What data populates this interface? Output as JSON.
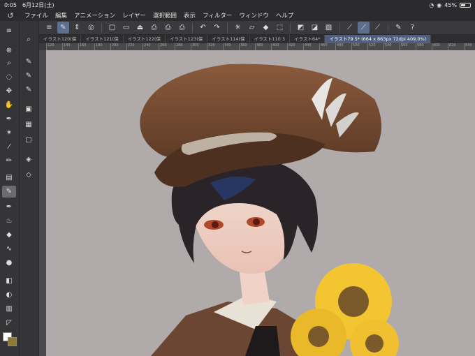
{
  "status": {
    "time": "0:05",
    "date": "6月12日(土)",
    "battery": "45%",
    "battery_level": 0.45
  },
  "menu": {
    "items": [
      "ファイル",
      "編集",
      "アニメーション",
      "レイヤー",
      "選択範囲",
      "表示",
      "フィルター",
      "ウィンドウ",
      "ヘルプ"
    ]
  },
  "tabs": [
    {
      "label": "イラスト120(保"
    },
    {
      "label": "イラスト121(保"
    },
    {
      "label": "イラスト122(保"
    },
    {
      "label": "イラスト123(保"
    },
    {
      "label": "イラスト114(保"
    },
    {
      "label": "イラスト110 3"
    },
    {
      "label": "イラスト64*"
    },
    {
      "label": "イラスト79 5* (664 x 863px 72dpi 409.0%)"
    }
  ],
  "ruler": {
    "ticks": [
      "120",
      "140",
      "160",
      "180",
      "200",
      "220",
      "240",
      "260",
      "280",
      "300",
      "320",
      "340",
      "360",
      "380",
      "400",
      "420",
      "440",
      "460",
      "480",
      "500",
      "520",
      "540",
      "560",
      "580",
      "600",
      "620",
      "640"
    ]
  },
  "icons": {
    "toolbar": [
      "menu-icon",
      "brush-size-icon",
      "stepper-icon",
      "view-icon",
      "new-icon",
      "open-icon",
      "save-icon",
      "export-icon",
      "export-icon",
      "export-icon",
      "undo-icon",
      "redo-icon",
      "loading-icon",
      "clear-icon",
      "fill-icon",
      "transform-icon",
      "select-icon",
      "select-icon",
      "select-icon",
      "ruler-icon",
      "ruler-active-icon",
      "ruler-icon",
      "settings-icon",
      "help-icon"
    ],
    "tools": [
      "zoom-icon",
      "magnifier-icon",
      "lasso-icon",
      "move-icon",
      "hand-icon",
      "pen-icon",
      "sparkle-icon",
      "eyedropper-icon",
      "pencil-icon",
      "texture-icon",
      "marker-icon",
      "pen-icon",
      "airbrush-icon",
      "eraser-icon",
      "vector-icon",
      "blend-icon",
      "gradient-icon",
      "bucket-icon",
      "grid-icon",
      "frame-icon",
      "color-icon"
    ]
  },
  "colors": {
    "accent": "#5d6f8e",
    "canvas_bg": "#b1aaaa",
    "hat": "#7a4e34",
    "hair": "#2a2428"
  }
}
